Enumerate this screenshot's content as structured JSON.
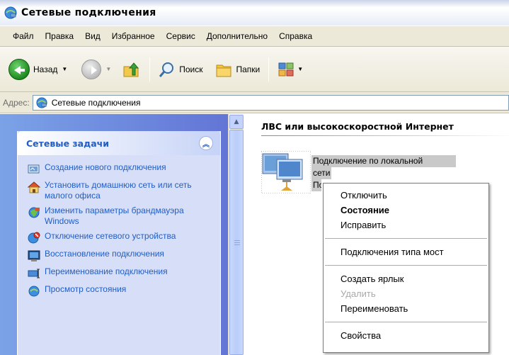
{
  "window": {
    "title": "Сетевые подключения"
  },
  "menu": [
    "Файл",
    "Правка",
    "Вид",
    "Избранное",
    "Сервис",
    "Дополнительно",
    "Справка"
  ],
  "toolbar": {
    "back_label": "Назад",
    "search_label": "Поиск",
    "folders_label": "Папки"
  },
  "address": {
    "label": "Адрес:",
    "value": "Сетевые подключения"
  },
  "tasks": {
    "header": "Сетевые задачи",
    "items": [
      {
        "label": "Создание нового подключения",
        "icon": "new-connection-icon"
      },
      {
        "label": "Установить домашнюю сеть или сеть малого офиса",
        "icon": "home-network-icon"
      },
      {
        "label": "Изменить параметры брандмауэра Windows",
        "icon": "firewall-icon"
      },
      {
        "label": "Отключение сетевого устройства",
        "icon": "disable-device-icon"
      },
      {
        "label": "Восстановление подключения",
        "icon": "repair-icon"
      },
      {
        "label": "Переименование подключения",
        "icon": "rename-icon"
      },
      {
        "label": "Просмотр состояния",
        "icon": "status-icon"
      }
    ]
  },
  "content": {
    "group_header": "ЛВС или высокоскоростной Интернет",
    "connection_line1": "Подключение по локальной",
    "connection_line2": "сети",
    "connection_line3": "По"
  },
  "context_menu": {
    "items": [
      {
        "label": "Отключить"
      },
      {
        "label": "Состояние",
        "bold": true
      },
      {
        "label": "Исправить"
      },
      {
        "label": "Подключения типа мост"
      },
      {
        "label": "Создать ярлык"
      },
      {
        "label": "Удалить",
        "disabled": true
      },
      {
        "label": "Переименовать"
      },
      {
        "label": "Свойства"
      }
    ]
  },
  "colors": {
    "task_link": "#215dc6",
    "panel_gradient_start": "#7ba2e7",
    "panel_gradient_end": "#6375d6",
    "selection": "#c9c9c9"
  }
}
